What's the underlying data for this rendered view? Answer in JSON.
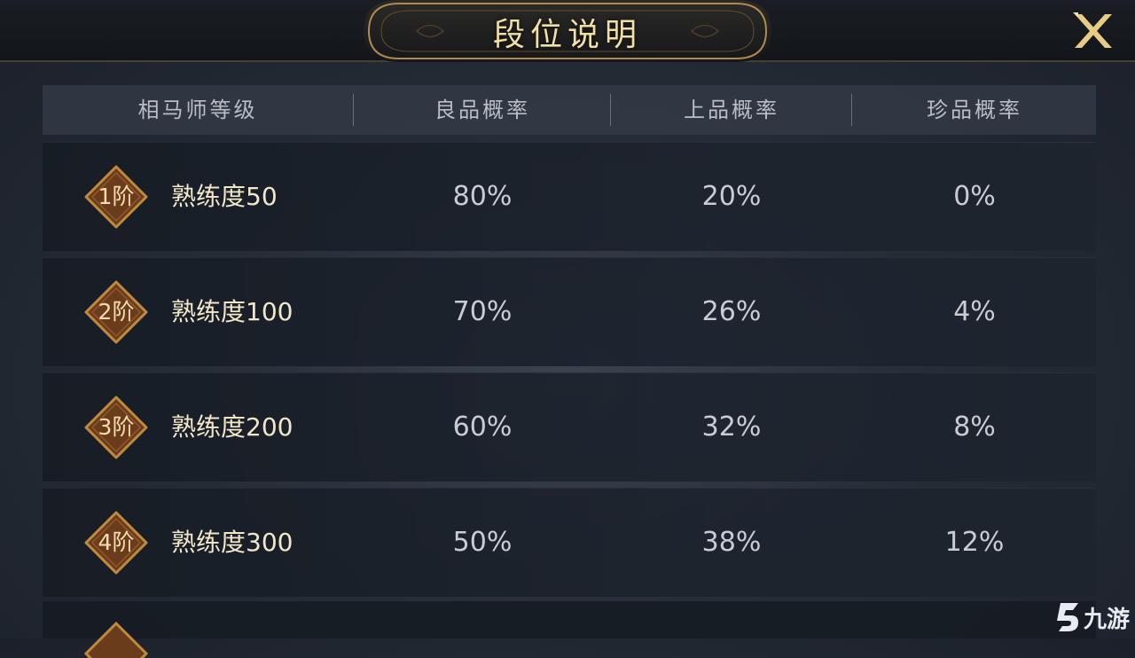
{
  "dialog": {
    "title": "段位说明"
  },
  "table": {
    "headers": [
      "相马师等级",
      "良品概率",
      "上品概率",
      "珍品概率"
    ],
    "rows": [
      {
        "badge": "1阶",
        "level": "熟练度50",
        "good": "80%",
        "fine": "20%",
        "rare": "0%"
      },
      {
        "badge": "2阶",
        "level": "熟练度100",
        "good": "70%",
        "fine": "26%",
        "rare": "4%"
      },
      {
        "badge": "3阶",
        "level": "熟练度200",
        "good": "60%",
        "fine": "32%",
        "rare": "8%"
      },
      {
        "badge": "4阶",
        "level": "熟练度300",
        "good": "50%",
        "fine": "38%",
        "rare": "12%"
      }
    ]
  },
  "watermark": {
    "text": "九游"
  },
  "colors": {
    "title": "#f1dfa8",
    "badge_bg": "#6a3c1c",
    "badge_border": "#c08a3e",
    "close": "#e7cc86"
  }
}
